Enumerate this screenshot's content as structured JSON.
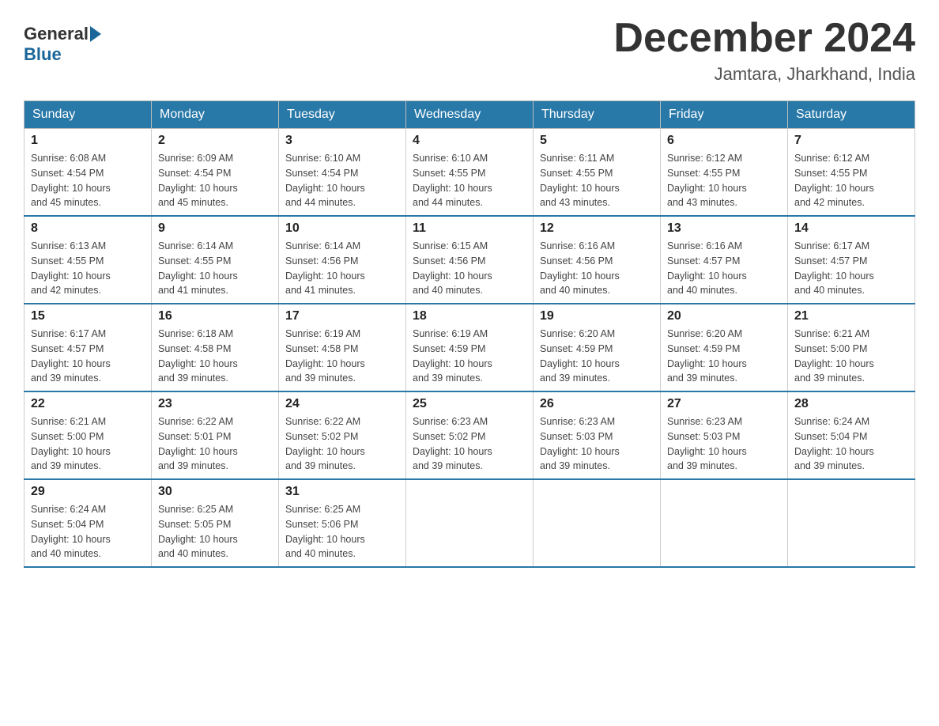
{
  "header": {
    "logo_general": "General",
    "logo_blue": "Blue",
    "month_title": "December 2024",
    "location": "Jamtara, Jharkhand, India"
  },
  "days_of_week": [
    "Sunday",
    "Monday",
    "Tuesday",
    "Wednesday",
    "Thursday",
    "Friday",
    "Saturday"
  ],
  "weeks": [
    [
      {
        "day": "1",
        "sunrise": "6:08 AM",
        "sunset": "4:54 PM",
        "daylight": "10 hours and 45 minutes."
      },
      {
        "day": "2",
        "sunrise": "6:09 AM",
        "sunset": "4:54 PM",
        "daylight": "10 hours and 45 minutes."
      },
      {
        "day": "3",
        "sunrise": "6:10 AM",
        "sunset": "4:54 PM",
        "daylight": "10 hours and 44 minutes."
      },
      {
        "day": "4",
        "sunrise": "6:10 AM",
        "sunset": "4:55 PM",
        "daylight": "10 hours and 44 minutes."
      },
      {
        "day": "5",
        "sunrise": "6:11 AM",
        "sunset": "4:55 PM",
        "daylight": "10 hours and 43 minutes."
      },
      {
        "day": "6",
        "sunrise": "6:12 AM",
        "sunset": "4:55 PM",
        "daylight": "10 hours and 43 minutes."
      },
      {
        "day": "7",
        "sunrise": "6:12 AM",
        "sunset": "4:55 PM",
        "daylight": "10 hours and 42 minutes."
      }
    ],
    [
      {
        "day": "8",
        "sunrise": "6:13 AM",
        "sunset": "4:55 PM",
        "daylight": "10 hours and 42 minutes."
      },
      {
        "day": "9",
        "sunrise": "6:14 AM",
        "sunset": "4:55 PM",
        "daylight": "10 hours and 41 minutes."
      },
      {
        "day": "10",
        "sunrise": "6:14 AM",
        "sunset": "4:56 PM",
        "daylight": "10 hours and 41 minutes."
      },
      {
        "day": "11",
        "sunrise": "6:15 AM",
        "sunset": "4:56 PM",
        "daylight": "10 hours and 40 minutes."
      },
      {
        "day": "12",
        "sunrise": "6:16 AM",
        "sunset": "4:56 PM",
        "daylight": "10 hours and 40 minutes."
      },
      {
        "day": "13",
        "sunrise": "6:16 AM",
        "sunset": "4:57 PM",
        "daylight": "10 hours and 40 minutes."
      },
      {
        "day": "14",
        "sunrise": "6:17 AM",
        "sunset": "4:57 PM",
        "daylight": "10 hours and 40 minutes."
      }
    ],
    [
      {
        "day": "15",
        "sunrise": "6:17 AM",
        "sunset": "4:57 PM",
        "daylight": "10 hours and 39 minutes."
      },
      {
        "day": "16",
        "sunrise": "6:18 AM",
        "sunset": "4:58 PM",
        "daylight": "10 hours and 39 minutes."
      },
      {
        "day": "17",
        "sunrise": "6:19 AM",
        "sunset": "4:58 PM",
        "daylight": "10 hours and 39 minutes."
      },
      {
        "day": "18",
        "sunrise": "6:19 AM",
        "sunset": "4:59 PM",
        "daylight": "10 hours and 39 minutes."
      },
      {
        "day": "19",
        "sunrise": "6:20 AM",
        "sunset": "4:59 PM",
        "daylight": "10 hours and 39 minutes."
      },
      {
        "day": "20",
        "sunrise": "6:20 AM",
        "sunset": "4:59 PM",
        "daylight": "10 hours and 39 minutes."
      },
      {
        "day": "21",
        "sunrise": "6:21 AM",
        "sunset": "5:00 PM",
        "daylight": "10 hours and 39 minutes."
      }
    ],
    [
      {
        "day": "22",
        "sunrise": "6:21 AM",
        "sunset": "5:00 PM",
        "daylight": "10 hours and 39 minutes."
      },
      {
        "day": "23",
        "sunrise": "6:22 AM",
        "sunset": "5:01 PM",
        "daylight": "10 hours and 39 minutes."
      },
      {
        "day": "24",
        "sunrise": "6:22 AM",
        "sunset": "5:02 PM",
        "daylight": "10 hours and 39 minutes."
      },
      {
        "day": "25",
        "sunrise": "6:23 AM",
        "sunset": "5:02 PM",
        "daylight": "10 hours and 39 minutes."
      },
      {
        "day": "26",
        "sunrise": "6:23 AM",
        "sunset": "5:03 PM",
        "daylight": "10 hours and 39 minutes."
      },
      {
        "day": "27",
        "sunrise": "6:23 AM",
        "sunset": "5:03 PM",
        "daylight": "10 hours and 39 minutes."
      },
      {
        "day": "28",
        "sunrise": "6:24 AM",
        "sunset": "5:04 PM",
        "daylight": "10 hours and 39 minutes."
      }
    ],
    [
      {
        "day": "29",
        "sunrise": "6:24 AM",
        "sunset": "5:04 PM",
        "daylight": "10 hours and 40 minutes."
      },
      {
        "day": "30",
        "sunrise": "6:25 AM",
        "sunset": "5:05 PM",
        "daylight": "10 hours and 40 minutes."
      },
      {
        "day": "31",
        "sunrise": "6:25 AM",
        "sunset": "5:06 PM",
        "daylight": "10 hours and 40 minutes."
      },
      null,
      null,
      null,
      null
    ]
  ],
  "labels": {
    "sunrise": "Sunrise:",
    "sunset": "Sunset:",
    "daylight": "Daylight:"
  }
}
